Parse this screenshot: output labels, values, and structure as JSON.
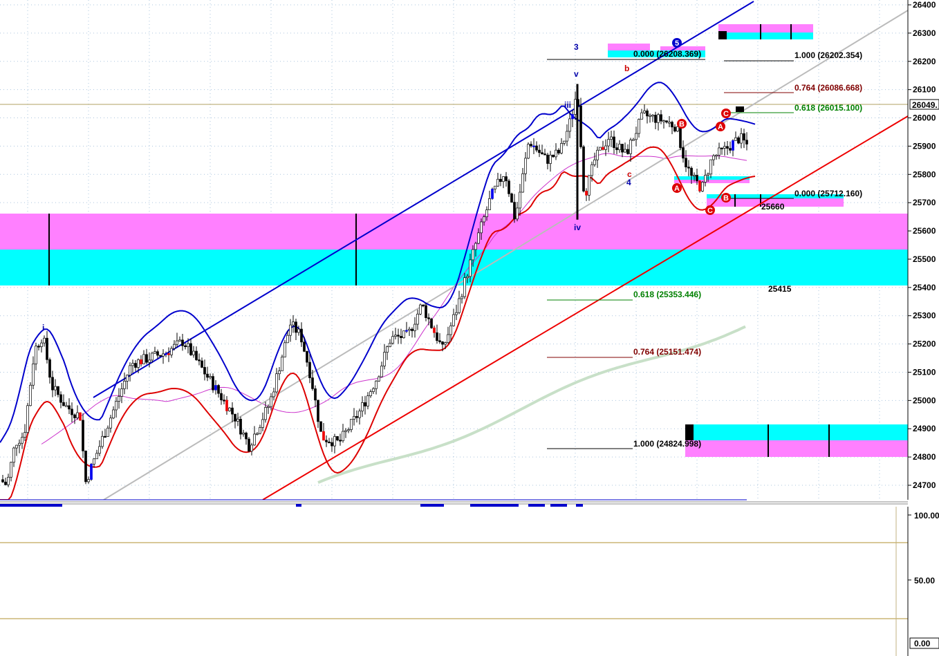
{
  "chart_data": {
    "type": "candlestick",
    "price_axis": {
      "ticks": [
        "26400",
        "26300",
        "26200",
        "26100",
        "26000",
        "25900",
        "25800",
        "25700",
        "25600",
        "25500",
        "25400",
        "25300",
        "25200",
        "25100",
        "25000",
        "24900",
        "24800",
        "24700"
      ],
      "current_price_label": "26049.",
      "current_price": 26049
    },
    "osc_axis": {
      "ticks": [
        "100.00",
        "50.00",
        "0.00"
      ]
    },
    "fib_upper": [
      {
        "text": "0.000 (26208.369)",
        "color": "#000000"
      },
      {
        "text": "1.000 (26202.354)",
        "color": "#000000"
      },
      {
        "text": "0.764 (26086.668)",
        "color": "#800000"
      },
      {
        "text": "0.618 (26015.100)",
        "color": "#008000"
      },
      {
        "text": "0.000 (25712.160)",
        "color": "#000000"
      }
    ],
    "fib_lower": [
      {
        "text": "0.618 (25353.446)",
        "color": "#008000"
      },
      {
        "text": "0.764 (25151.474)",
        "color": "#800000"
      },
      {
        "text": "1.000 (24824.998)",
        "color": "#000000"
      }
    ],
    "price_labels": [
      "25660",
      "25415"
    ],
    "wave_labels": {
      "i": "i",
      "iii": "iii",
      "v": "v",
      "iv": "iv",
      "three": "3",
      "four": "4",
      "b": "b",
      "c": "c"
    },
    "circled_labels": {
      "five": "5",
      "A": "A",
      "B": "B",
      "C": "C"
    },
    "colors": {
      "upper_channel": "#0000cc",
      "lower_channel": "#ee0000",
      "bollinger_upper": "#0000cc",
      "bollinger_lower": "#dd0000",
      "ma_slow": "#c8e0c8",
      "ma_mid": "#cc33cc",
      "zone_magenta": "#ff80ff",
      "zone_cyan": "#00ffff",
      "stoch_k": "#0000cc",
      "stoch_d": "#cc0000"
    }
  }
}
